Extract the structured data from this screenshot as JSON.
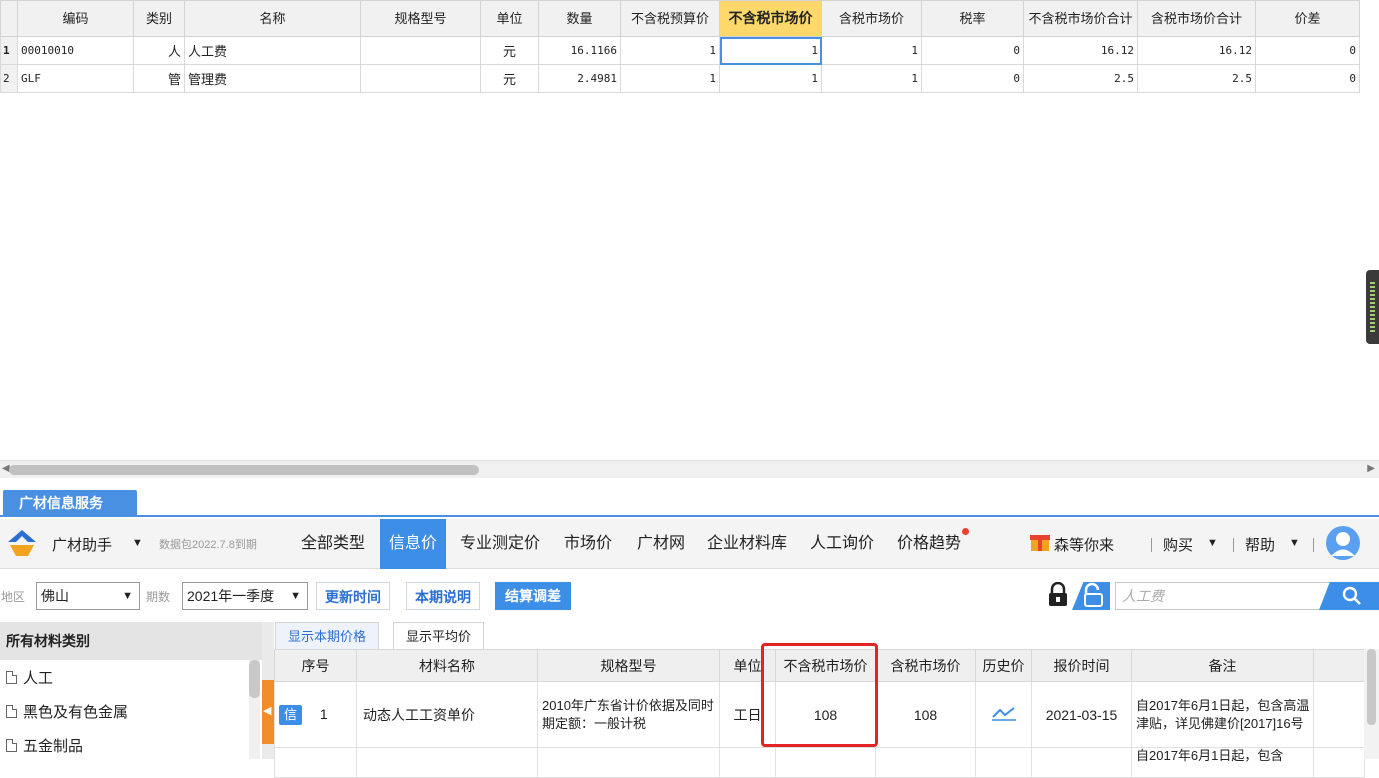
{
  "grid": {
    "headers": [
      "编码",
      "类别",
      "名称",
      "规格型号",
      "单位",
      "数量",
      "不含税预算价",
      "不含税市场价",
      "含税市场价",
      "税率",
      "不含税市场价合计",
      "含税市场价合计",
      "价差"
    ],
    "rows": [
      {
        "no": "1",
        "code": "00010010",
        "type": "人",
        "name": "人工费",
        "spec": "",
        "unit": "元",
        "qty": "16.1166",
        "budget": "1",
        "market": "1",
        "market_tax": "1",
        "rate": "0",
        "sum_market": "16.12",
        "sum_market_tax": "16.12",
        "diff": "0"
      },
      {
        "no": "2",
        "code": "GLF",
        "type": "管",
        "name": "管理费",
        "spec": "",
        "unit": "元",
        "qty": "2.4981",
        "budget": "1",
        "market": "1",
        "market_tax": "1",
        "rate": "0",
        "sum_market": "2.5",
        "sum_market_tax": "2.5",
        "diff": "0"
      }
    ]
  },
  "service": {
    "tab_label": "广材信息服务",
    "assistant_label": "广材助手",
    "package_note": "数据包2022.7.8到期",
    "nav": [
      "全部类型",
      "信息价",
      "专业测定价",
      "市场价",
      "广材网",
      "企业材料库",
      "人工询价",
      "价格趋势"
    ],
    "active_nav": "信息价",
    "promo_text": "森等你来",
    "buy_label": "购买",
    "help_label": "帮助"
  },
  "filters": {
    "region_label": "地区",
    "region_value": "佛山",
    "period_label": "期数",
    "period_value": "2021年一季度",
    "update_time_btn": "更新时间",
    "period_note_btn": "本期说明",
    "settle_btn": "结算调差",
    "search_placeholder": "人工费"
  },
  "categories": {
    "header": "所有材料类别",
    "items": [
      "人工",
      "黑色及有色金属",
      "五金制品"
    ]
  },
  "price_tabs": [
    "显示本期价格",
    "显示平均价"
  ],
  "price_table": {
    "headers": [
      "序号",
      "材料名称",
      "规格型号",
      "单位",
      "不含税市场价",
      "含税市场价",
      "历史价",
      "报价时间",
      "备注"
    ],
    "rows": [
      {
        "badge": "信",
        "no": "1",
        "name": "动态人工工资单价",
        "spec": "2010年广东省计价依据及同时期定额：一般计税",
        "unit": "工日",
        "price": "108",
        "price_tax": "108",
        "date": "2021-03-15",
        "note": "自2017年6月1日起，包含高温津贴，详见佛建价[2017]16号"
      },
      {
        "badge": "",
        "no": "",
        "name": "",
        "spec": "",
        "unit": "",
        "price": "",
        "price_tax": "",
        "date": "",
        "note": "自2017年6月1日起，包含"
      }
    ]
  },
  "colors": {
    "accent": "#3d8ee6",
    "header_highlight": "#ffd86b",
    "annotation_box": "#e22424",
    "collapse_tab": "#f28c28"
  }
}
